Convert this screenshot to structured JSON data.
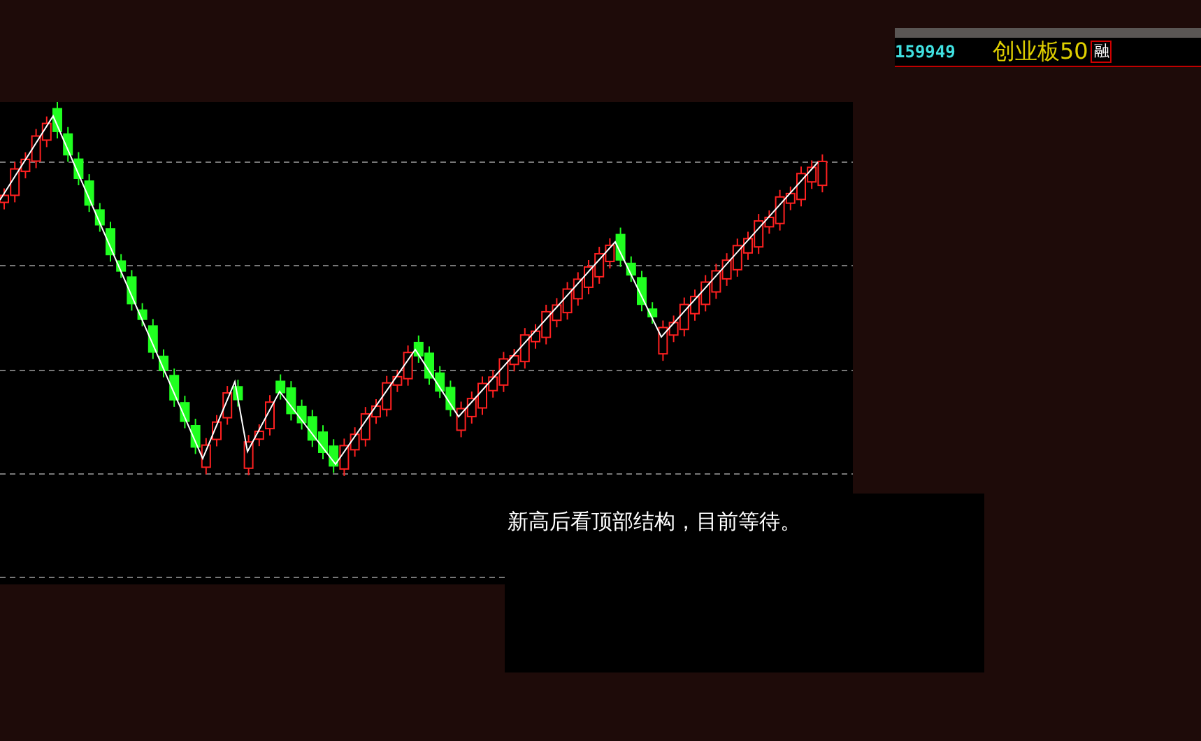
{
  "quote": {
    "code": "159949",
    "name": "创业板50",
    "badge": "融"
  },
  "note": {
    "text": "新高后看顶部结构，目前等待。"
  }
}
